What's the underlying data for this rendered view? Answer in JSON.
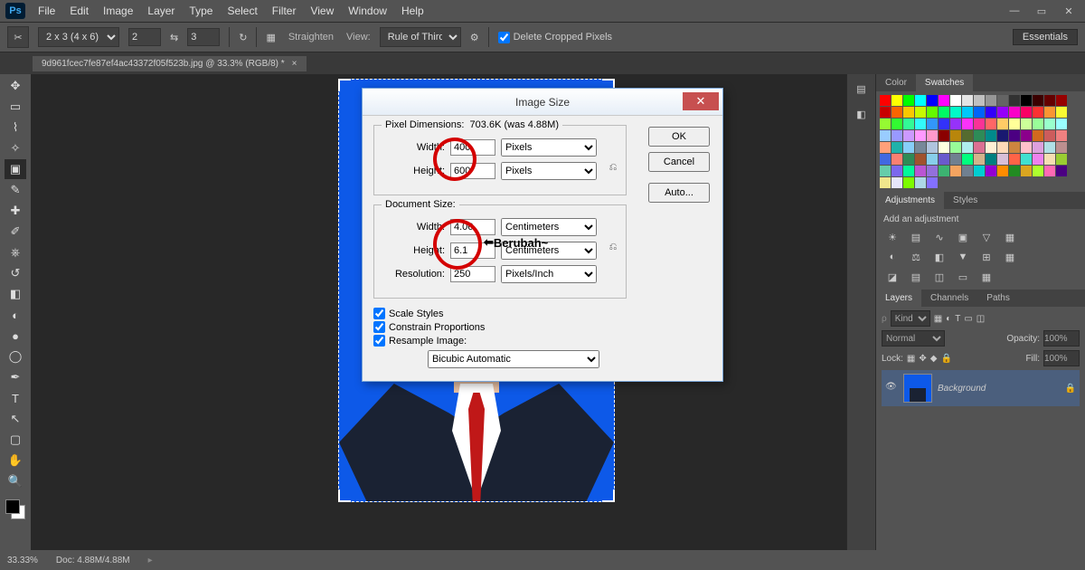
{
  "app": {
    "logo": "Ps"
  },
  "menubar": [
    "File",
    "Edit",
    "Image",
    "Layer",
    "Type",
    "Select",
    "Filter",
    "View",
    "Window",
    "Help"
  ],
  "optionsbar": {
    "ratio": "2 x 3 (4 x 6)",
    "w": "2",
    "h": "3",
    "straighten": "Straighten",
    "view_label": "View:",
    "view_value": "Rule of Thirds",
    "delete_crop_label": "Delete Cropped Pixels",
    "workspace": "Essentials"
  },
  "tab": {
    "name": "9d961fcec7fe87ef4ac43372f05f523b.jpg @ 33.3%  (RGB/8) *"
  },
  "dialog": {
    "title": "Image Size",
    "pixel_dim_label": "Pixel Dimensions:",
    "pixel_dim_value": "703.6K (was 4.88M)",
    "width_label": "Width:",
    "height_label": "Height:",
    "pixel_width": "400",
    "pixel_height": "600",
    "pixel_unit": "Pixels",
    "doc_size_label": "Document Size:",
    "doc_width": "4.06",
    "doc_height": "6.1",
    "doc_unit": "Centimeters",
    "resolution_label": "Resolution:",
    "resolution": "250",
    "resolution_unit": "Pixels/Inch",
    "scale_styles": "Scale Styles",
    "constrain": "Constrain Proportions",
    "resample": "Resample Image:",
    "resample_method": "Bicubic Automatic",
    "ok": "OK",
    "cancel": "Cancel",
    "auto": "Auto...",
    "annotation": "Berubah~"
  },
  "panels": {
    "color_tab": "Color",
    "swatches_tab": "Swatches",
    "adjustments_tab": "Adjustments",
    "styles_tab": "Styles",
    "add_adjustment": "Add an adjustment",
    "layers_tab": "Layers",
    "channels_tab": "Channels",
    "paths_tab": "Paths",
    "kind_label": "Kind",
    "blend_mode": "Normal",
    "opacity_label": "Opacity:",
    "opacity_value": "100%",
    "lock_label": "Lock:",
    "fill_label": "Fill:",
    "fill_value": "100%",
    "layer_name": "Background"
  },
  "statusbar": {
    "zoom": "33.33%",
    "doc": "Doc: 4.88M/4.88M"
  },
  "swatch_colors": [
    "#ff0000",
    "#ffff00",
    "#00ff00",
    "#00ffff",
    "#0000ff",
    "#ff00ff",
    "#ffffff",
    "#e4e4e4",
    "#c0c0c0",
    "#969696",
    "#646464",
    "#323232",
    "#000000",
    "#3b0000",
    "#640000",
    "#960000",
    "#c80000",
    "#fa6400",
    "#fac800",
    "#c8fa00",
    "#64fa00",
    "#00fa64",
    "#00fac8",
    "#00c8fa",
    "#0064fa",
    "#3200fa",
    "#9600fa",
    "#fa00c8",
    "#fa0064",
    "#fa3232",
    "#fa9632",
    "#fafa32",
    "#96fa32",
    "#32fa32",
    "#32fa96",
    "#32fafa",
    "#3296fa",
    "#3232fa",
    "#9632fa",
    "#fa32fa",
    "#fa3296",
    "#ff6666",
    "#ffcc66",
    "#ffff99",
    "#ccff99",
    "#99ff99",
    "#99ffcc",
    "#99ffff",
    "#99ccff",
    "#9999ff",
    "#cc99ff",
    "#ff99ff",
    "#ff99cc",
    "#8b0000",
    "#b8860b",
    "#556b2f",
    "#2e8b57",
    "#008b8b",
    "#191970",
    "#4b0082",
    "#8b008b",
    "#d2691e",
    "#cd5c5c",
    "#f08080",
    "#ffa07a",
    "#20b2aa",
    "#87cefa",
    "#778899",
    "#b0c4de",
    "#ffffe0",
    "#98fb98",
    "#afeeee",
    "#db7093",
    "#ffefd5",
    "#ffdab9",
    "#cd853f",
    "#ffc0cb",
    "#dda0dd",
    "#b0e0e6",
    "#bc8f8f",
    "#4169e1",
    "#fa8072",
    "#2e8b57",
    "#a0522d",
    "#87ceeb",
    "#6a5acd",
    "#708090",
    "#00ff7f",
    "#d2b48c",
    "#008080",
    "#d8bfd8",
    "#ff6347",
    "#40e0d0",
    "#ee82ee",
    "#f5deb3",
    "#9acd32",
    "#66cdaa",
    "#7b68ee",
    "#00fa9a",
    "#ba55d3",
    "#9370db",
    "#3cb371",
    "#f4a460",
    "#708090",
    "#00ced1",
    "#9400d3",
    "#ff8c00",
    "#228b22",
    "#daa520",
    "#adff2f",
    "#ff69b4",
    "#4b0082",
    "#f0e68c",
    "#e6e6fa",
    "#7cfc00",
    "#add8e6",
    "#8470ff"
  ]
}
